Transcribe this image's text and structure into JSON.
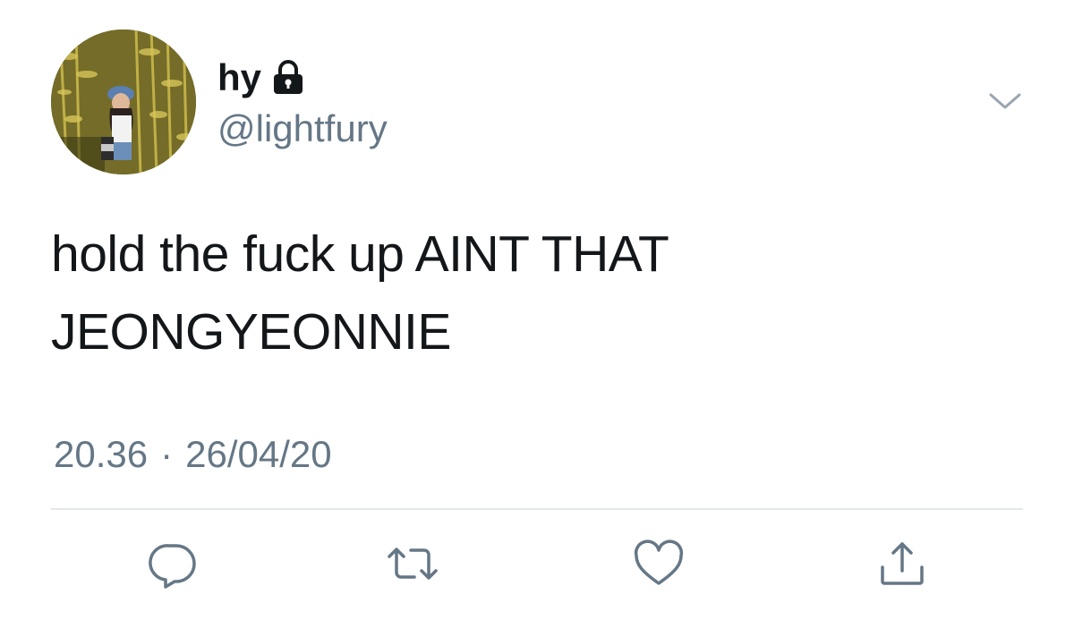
{
  "user": {
    "display_name": "hy",
    "handle": "@lightfury",
    "protected_icon": "lock-icon",
    "avatar": "profile-photo"
  },
  "tweet": {
    "text_line1": "hold the fuck up AINT THAT",
    "text_line2": "JEONGYEONNIE",
    "time": "20.36",
    "separator": "·",
    "date": "26/04/20"
  },
  "actions": [
    {
      "name": "reply",
      "icon": "reply-icon"
    },
    {
      "name": "retweet",
      "icon": "retweet-icon"
    },
    {
      "name": "like",
      "icon": "heart-icon"
    },
    {
      "name": "share",
      "icon": "share-icon"
    }
  ],
  "menu": {
    "icon": "chevron-down-icon"
  },
  "colors": {
    "text_primary": "#14171a",
    "text_secondary": "#657786",
    "divider": "#e1e8ed",
    "icon": "#657786"
  }
}
